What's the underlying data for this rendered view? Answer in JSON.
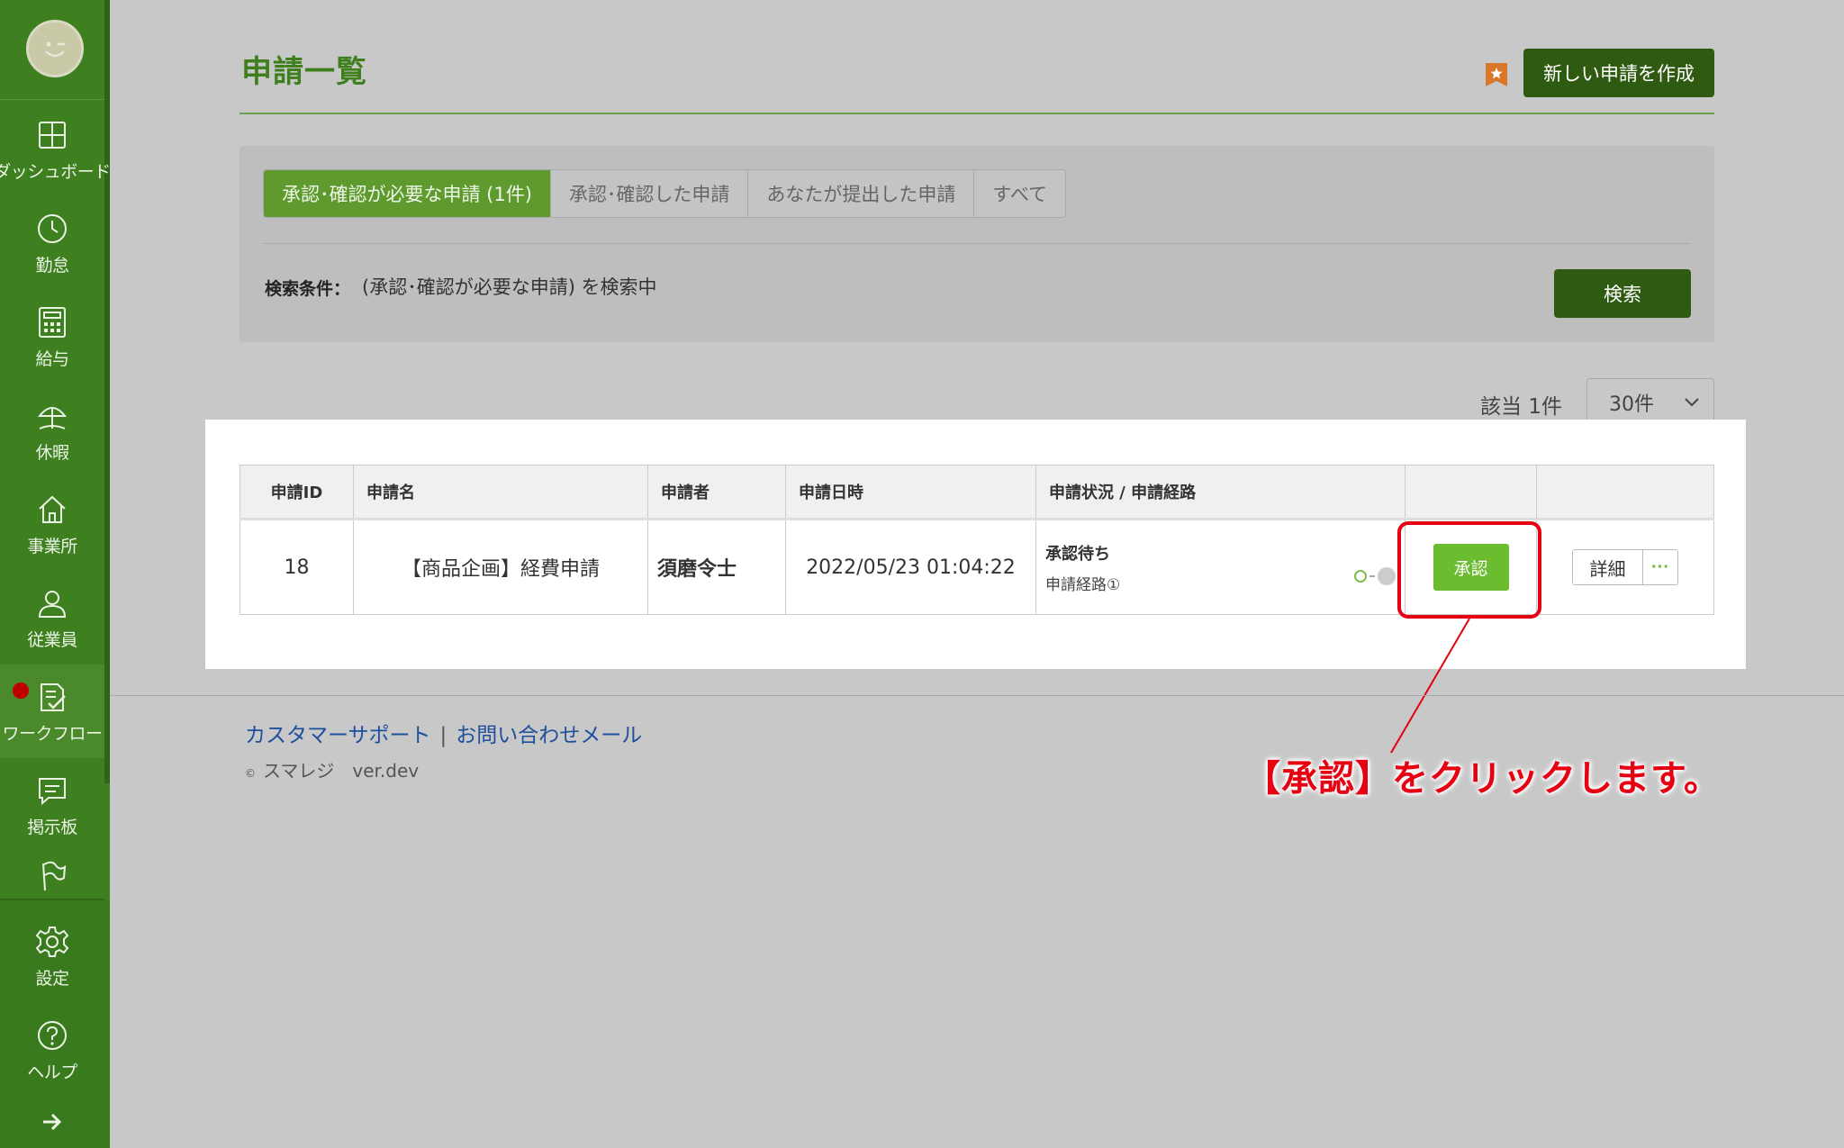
{
  "page": {
    "title": "申請一覧",
    "create_button": "新しい申請を作成"
  },
  "sidebar": {
    "items": [
      {
        "label": "ダッシュボード",
        "icon": "dashboard-icon"
      },
      {
        "label": "勤怠",
        "icon": "clock-icon"
      },
      {
        "label": "給与",
        "icon": "calculator-icon"
      },
      {
        "label": "休暇",
        "icon": "parasol-icon"
      },
      {
        "label": "事業所",
        "icon": "home-icon"
      },
      {
        "label": "従業員",
        "icon": "person-icon"
      },
      {
        "label": "ワークフロー",
        "icon": "workflow-icon",
        "active": true,
        "badge": true
      },
      {
        "label": "掲示板",
        "icon": "chat-icon"
      },
      {
        "label": "",
        "icon": "flag-icon"
      },
      {
        "label": "設定",
        "icon": "gear-icon"
      },
      {
        "label": "ヘルプ",
        "icon": "help-icon"
      }
    ]
  },
  "filter": {
    "tabs": [
      {
        "label": "承認･確認が必要な申請 (1件)",
        "active": true
      },
      {
        "label": "承認･確認した申請"
      },
      {
        "label": "あなたが提出した申請"
      },
      {
        "label": "すべて"
      }
    ],
    "condition_label": "検索条件：",
    "condition_text": "(承認･確認が必要な申請) を検索中",
    "search_button": "検索"
  },
  "results": {
    "count_text": "該当 1件",
    "per_page": "30件"
  },
  "table": {
    "headers": [
      "申請ID",
      "申請名",
      "申請者",
      "申請日時",
      "申請状況 / 申請経路",
      "",
      ""
    ],
    "rows": [
      {
        "id": "18",
        "name": "【商品企画】経費申請",
        "applicant": "須磨令士",
        "date": "2022/05/23 01:04:22",
        "status": "承認待ち",
        "route": "申請経路①",
        "approve_label": "承認",
        "detail_label": "詳細",
        "more_label": "···"
      }
    ]
  },
  "annotation": {
    "callout": "【承認】をクリックします。",
    "color": "#e60012"
  },
  "footer": {
    "link1": "カスタマーサポート",
    "separator": "|",
    "link2": "お問い合わせメール",
    "copyright_symbol": "©",
    "copyright": "スマレジ　ver.dev"
  },
  "colors": {
    "sidebar": "#3e7f20",
    "primary_dark": "#2f5a12",
    "approve": "#6cbc2f",
    "title": "#3f7f1e"
  }
}
